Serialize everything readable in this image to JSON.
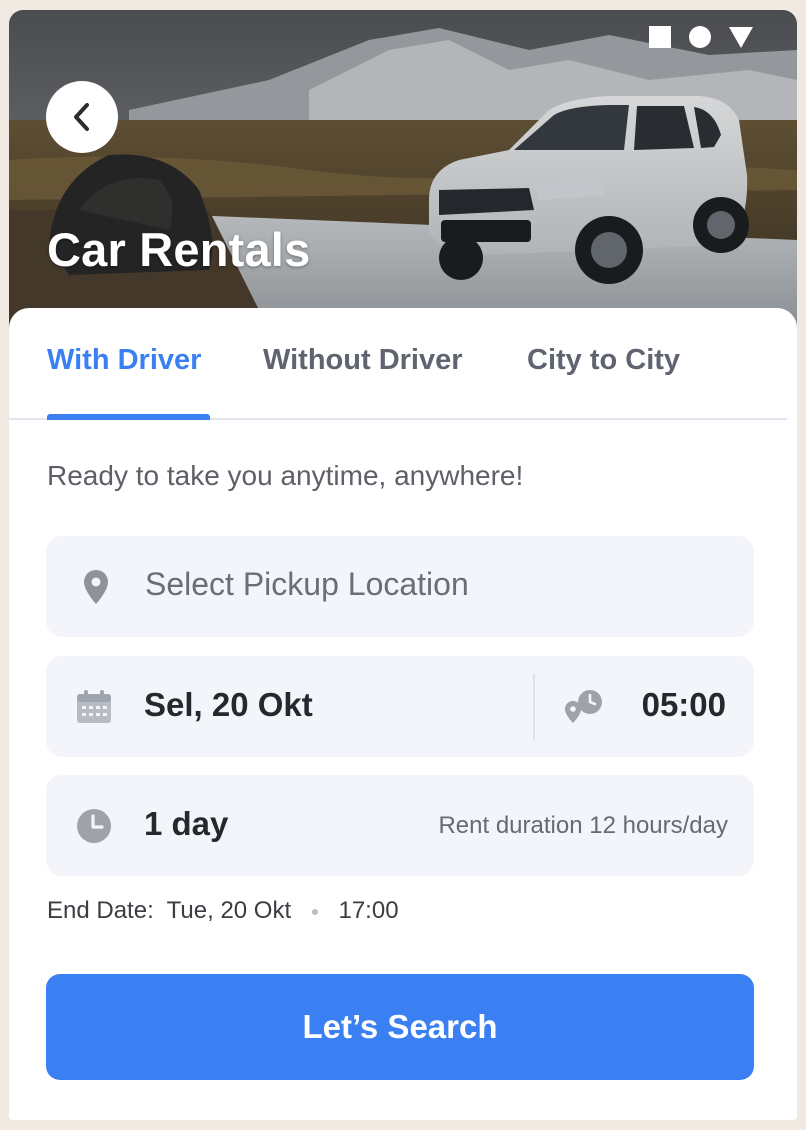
{
  "header": {
    "title": "Car Rentals"
  },
  "tabs": [
    {
      "label": "With Driver",
      "active": true
    },
    {
      "label": "Without Driver",
      "active": false
    },
    {
      "label": "City to City",
      "active": false
    }
  ],
  "form": {
    "tagline": "Ready to take you anytime, anywhere!",
    "pickup_placeholder": "Select Pickup Location",
    "date_value": "Sel, 20 Okt",
    "time_value": "05:00",
    "duration_value": "1 day",
    "duration_note": "Rent duration 12 hours/day",
    "end_date_label": "End Date:",
    "end_date_value": "Tue, 20 Okt",
    "end_time_value": "17:00",
    "search_label": "Let’s Search"
  },
  "icons": {
    "back": "chevron-left-icon",
    "pickup": "location-pin-icon",
    "date": "calendar-icon",
    "time": "pin-clock-icon",
    "duration": "clock-icon"
  },
  "colors": {
    "accent": "#3a80f3",
    "field_bg": "#f3f5fa",
    "page_bg": "#efe9e1"
  }
}
